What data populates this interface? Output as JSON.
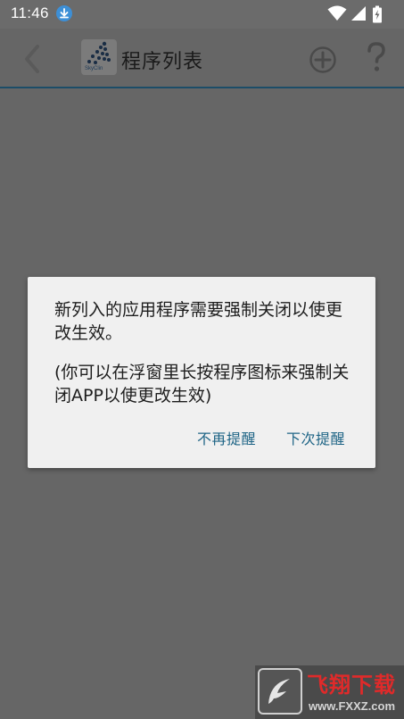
{
  "status_bar": {
    "time": "11:46"
  },
  "icons": {
    "download": "download-icon",
    "wifi": "wifi-icon",
    "signal": "signal-icon",
    "battery": "battery-charging-icon",
    "back": "chevron-left-icon",
    "add": "add-circle-icon",
    "help": "help-icon"
  },
  "app_bar": {
    "logo_text": "SkyClin",
    "title": "程序列表"
  },
  "dialog": {
    "message": "新列入的应用程序需要强制关闭以使更改生效。",
    "hint": "(你可以在浮窗里长按程序图标来强制关闭APP以使更改生效)",
    "buttons": {
      "no_remind": "不再提醒",
      "next_remind": "下次提醒"
    }
  },
  "watermark": {
    "brand": "飞翔下载",
    "url": "www.FXXZ.com"
  },
  "colors": {
    "background": "#666666",
    "dialog_background": "#f0f0f0",
    "button_text": "#1f6586",
    "action_bar_line": "#1c4d68",
    "watermark_brand": "#e02a2a"
  }
}
